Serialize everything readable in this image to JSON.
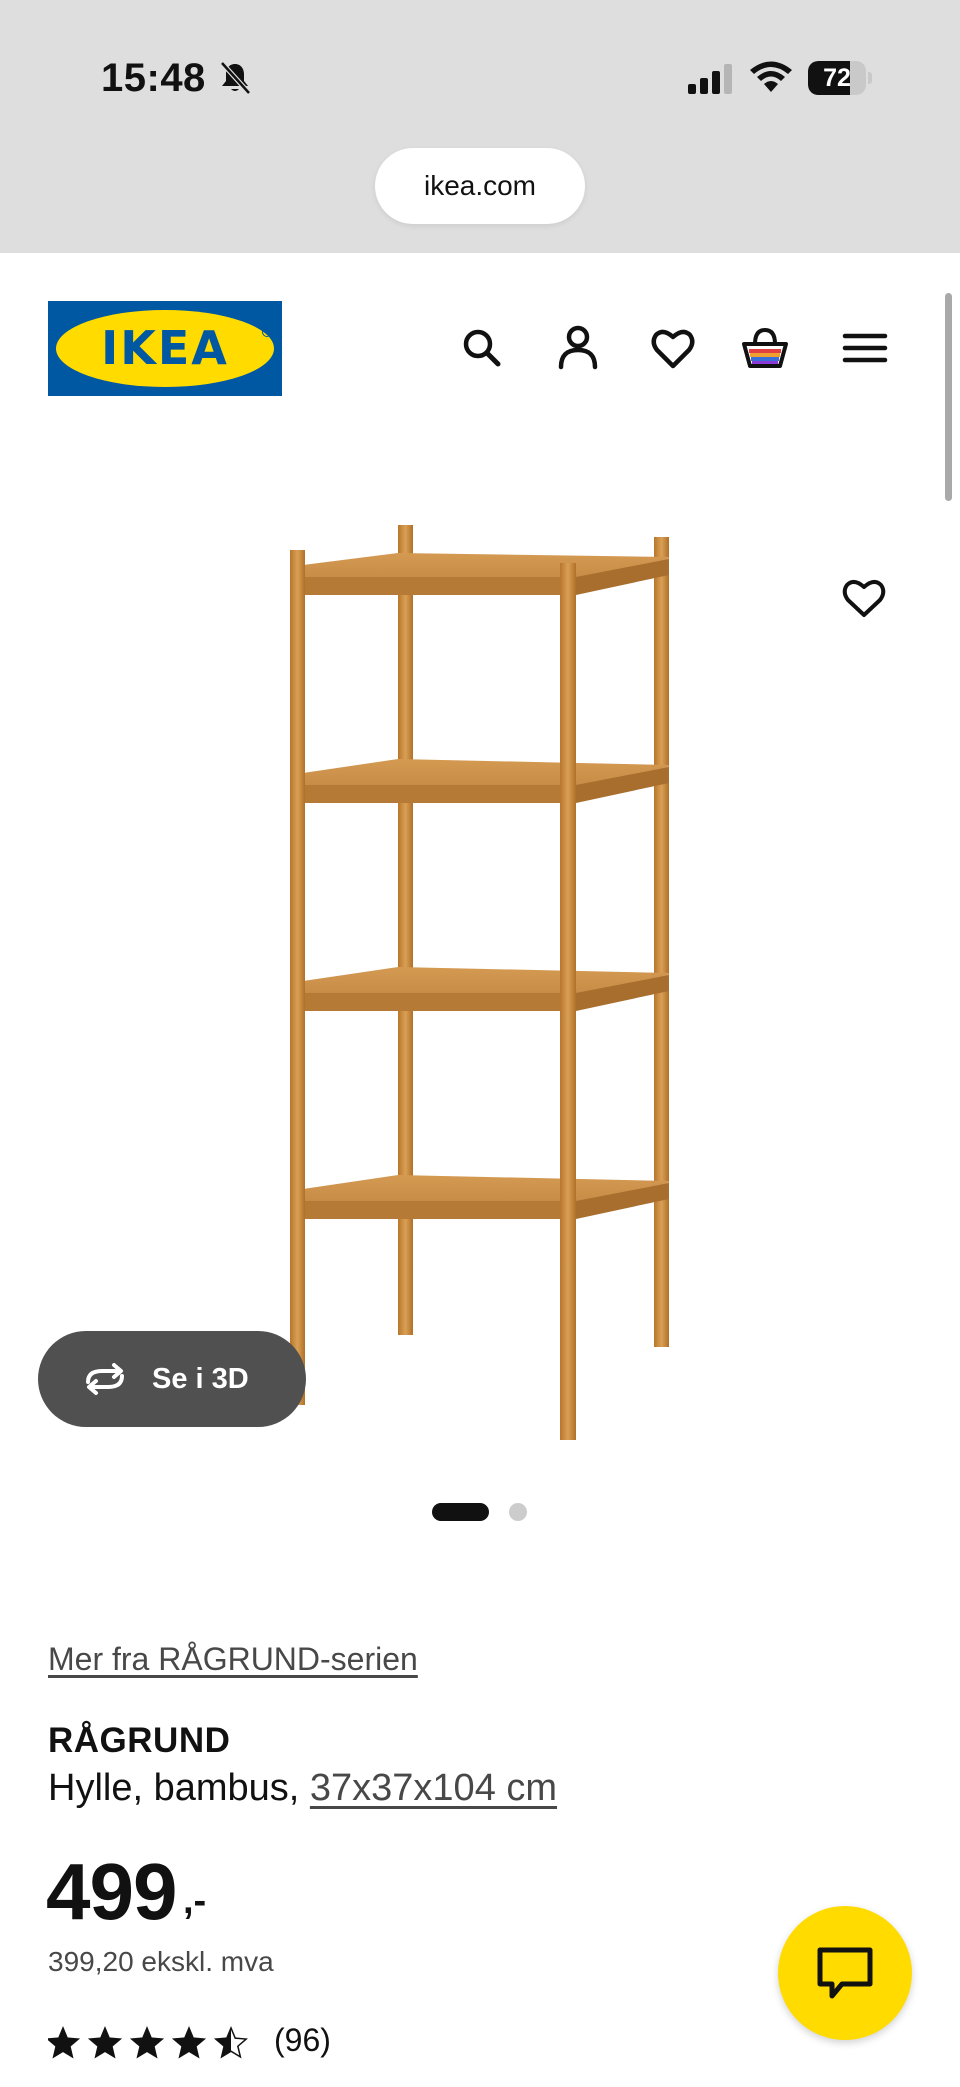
{
  "status_bar": {
    "time": "15:48",
    "battery_percent": "72",
    "battery_level": 0.72,
    "icons": [
      "bell-slash-icon",
      "cellular-signal-icon",
      "wifi-icon",
      "battery-icon"
    ]
  },
  "browser": {
    "url": "ikea.com"
  },
  "header": {
    "logo_text": "IKEA",
    "nav_icons": [
      "search-icon",
      "account-icon",
      "wishlist-heart-icon",
      "shopping-bag-icon",
      "hamburger-menu-icon"
    ]
  },
  "gallery": {
    "view_3d_label": "Se i 3D",
    "image_count": 2,
    "active_image": 1
  },
  "product": {
    "series_link": "Mer fra RÅGRUND-serien",
    "name": "RÅGRUND",
    "description": "Hylle, bambus,",
    "dimensions": "37x37x104 cm",
    "price": "499",
    "price_suffix": ",-",
    "price_ex_vat": "399,20 ekskl. mva",
    "rating": 4.5,
    "rating_max": 5,
    "review_count": "(96)"
  },
  "colors": {
    "ikea_blue": "#0058a3",
    "ikea_yellow": "#ffdb00",
    "bamboo": "#c98b3c",
    "button_dark": "#505050"
  }
}
